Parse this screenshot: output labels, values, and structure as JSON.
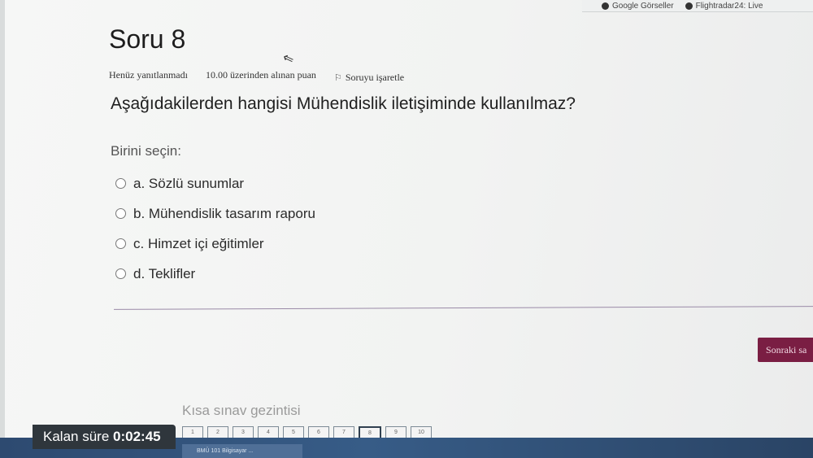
{
  "bookmarks": [
    {
      "label": "Google Görseller",
      "icon": "google-icon"
    },
    {
      "label": "Flightradar24: Live",
      "icon": "flightradar-icon"
    }
  ],
  "question": {
    "title": "Soru 8",
    "status": "Henüz yanıtlanmadı",
    "points": "10.00 üzerinden alınan puan",
    "flag_label": "Soruyu işaretle",
    "text": "Aşağıdakilerden hangisi Mühendislik iletişiminde kullanılmaz?",
    "prompt": "Birini seçin:",
    "options": [
      {
        "label": "a. Sözlü sunumlar"
      },
      {
        "label": "b. Mühendislik tasarım raporu"
      },
      {
        "label": "c. Himzet içi eğitimler"
      },
      {
        "label": "d. Teklifler"
      }
    ]
  },
  "actions": {
    "next_label": "Sonraki sa"
  },
  "navigation": {
    "title": "Kısa sınav gezintisi",
    "pages": [
      "1",
      "2",
      "3",
      "4",
      "5",
      "6",
      "7",
      "8",
      "9",
      "10"
    ],
    "current": "8"
  },
  "timer": {
    "label": "Kalan süre",
    "value": "0:02:45"
  },
  "taskbar": {
    "item": "BMÜ 101 Bilgisayar ..."
  }
}
